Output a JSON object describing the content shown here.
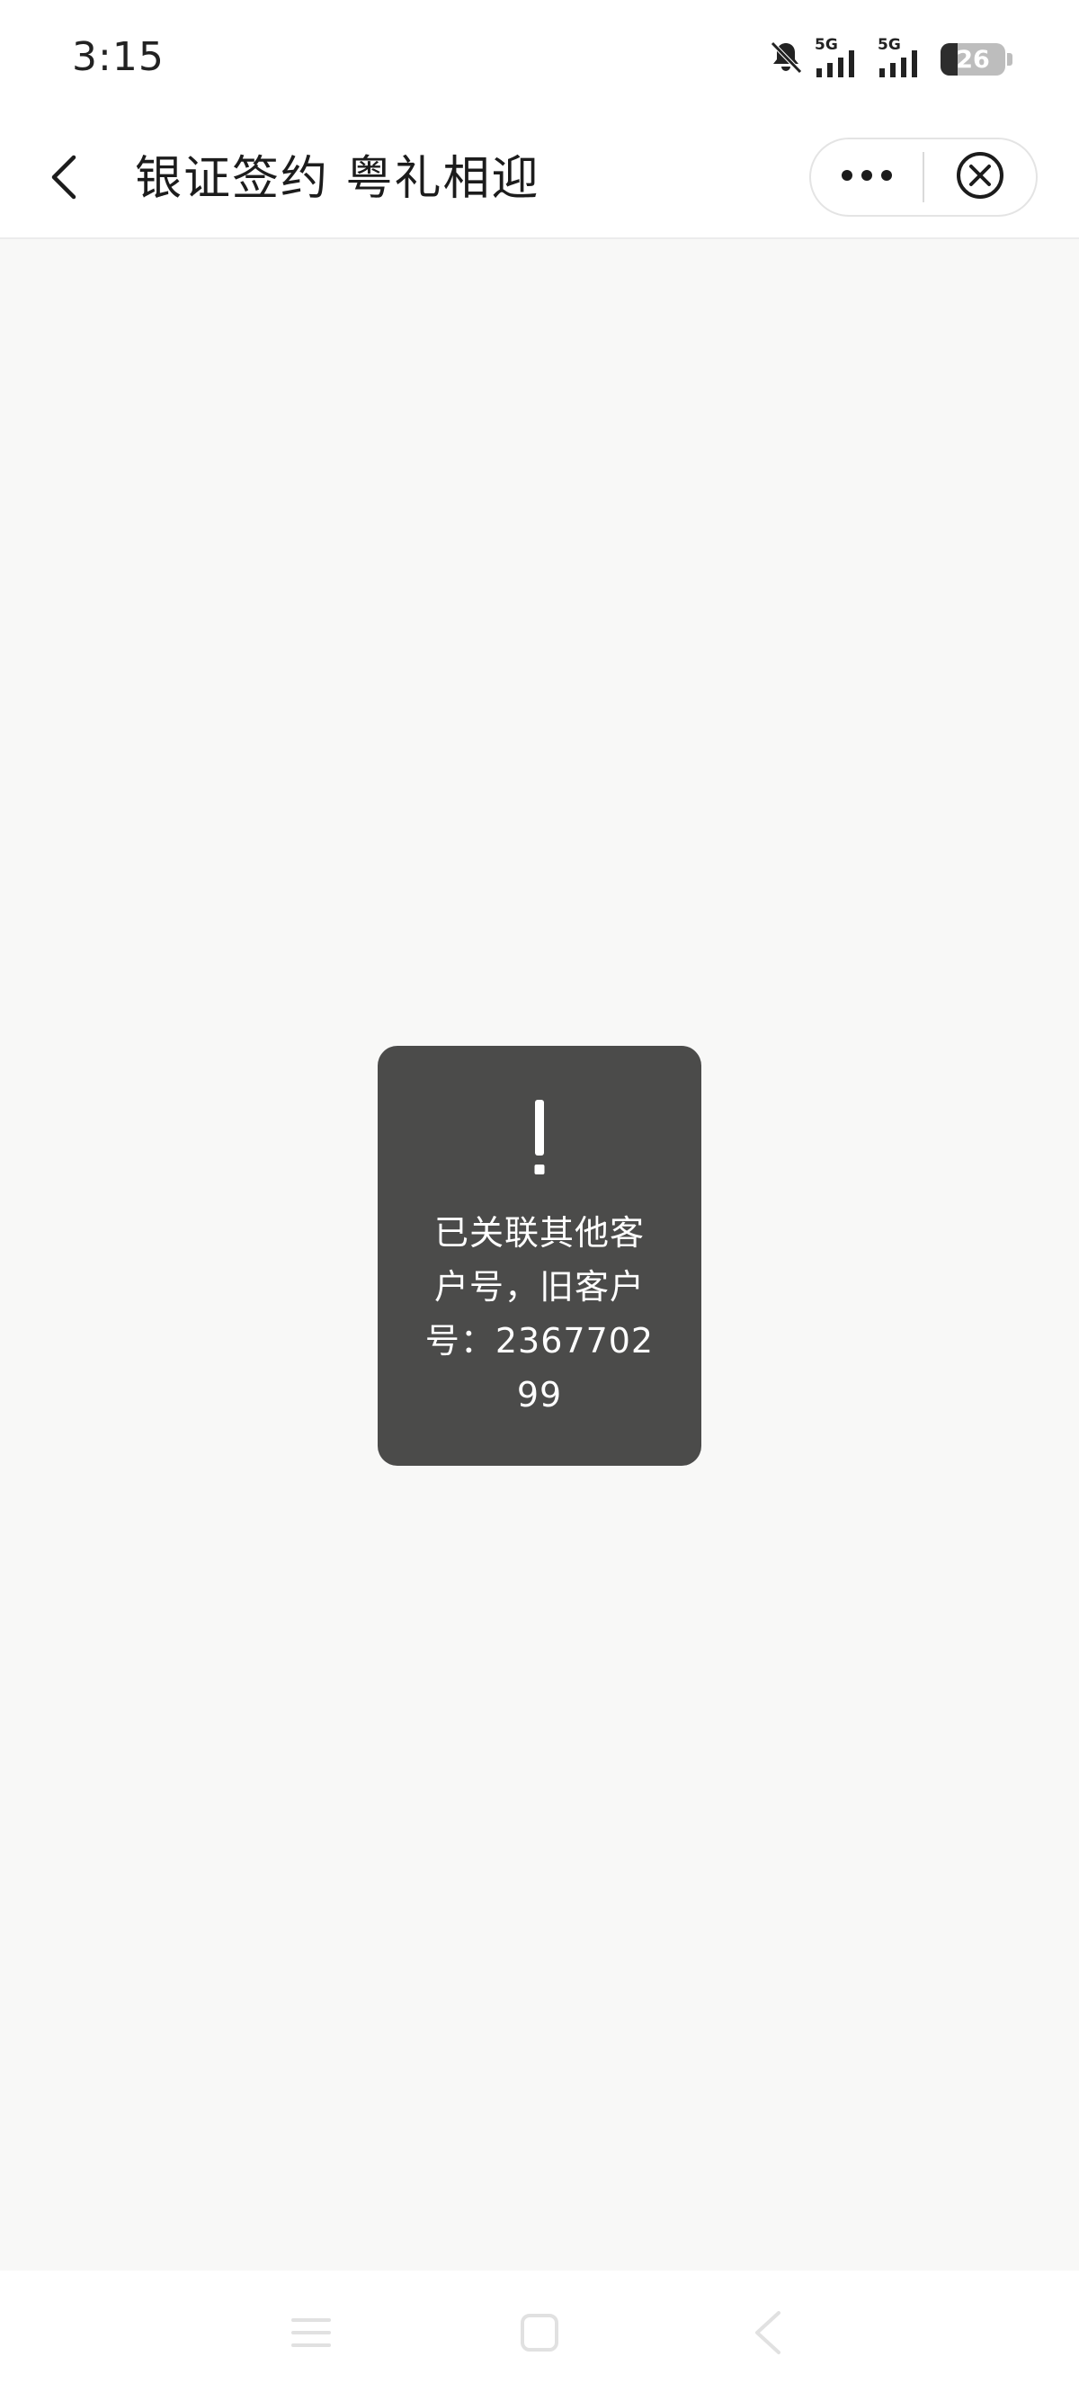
{
  "status_bar": {
    "time": "3:15",
    "network_1": "5G",
    "network_2": "5G",
    "battery_level": "26",
    "battery_percent": 26
  },
  "nav": {
    "title": "银证签约 粤礼相迎",
    "back_icon": "chevron-left-icon",
    "more_icon": "more-dots-icon",
    "close_icon": "close-circle-icon"
  },
  "toast": {
    "icon": "exclamation-icon",
    "message": "已关联其他客户号，旧客户号：236770299"
  },
  "system_nav": {
    "menu_icon": "menu-icon",
    "home_icon": "home-square-icon",
    "back_icon": "back-triangle-icon"
  },
  "colors": {
    "page_background": "#f8f8f7",
    "toast_background": "#4b4b4a",
    "bar_background": "#ffffff",
    "text_primary": "#1c1c1c"
  }
}
